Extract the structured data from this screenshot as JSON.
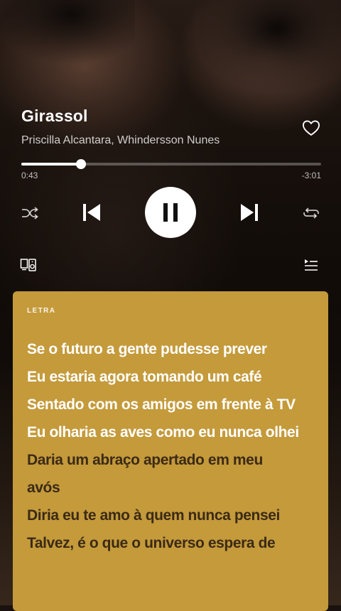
{
  "track": {
    "title": "Girassol",
    "artist": "Priscilla Alcantara, Whindersson Nunes"
  },
  "playback": {
    "elapsed": "0:43",
    "remaining": "-3:01",
    "progress_fraction": 0.2
  },
  "icons": {
    "heart": "heart-outline-icon",
    "shuffle": "shuffle-icon",
    "previous": "skip-previous-icon",
    "pause": "pause-icon",
    "next": "skip-next-icon",
    "repeat": "repeat-icon",
    "devices": "devices-icon",
    "queue": "queue-icon"
  },
  "lyrics": {
    "header": "LETRA",
    "card_color": "#c49a3b",
    "lines": [
      {
        "text": "Se o futuro a gente pudesse prever",
        "state": "past"
      },
      {
        "text": "Eu estaria agora tomando um café",
        "state": "past"
      },
      {
        "text": "Sentado com os amigos em frente à TV",
        "state": "past"
      },
      {
        "text": "Eu olharia as aves como eu nunca olhei",
        "state": "past"
      },
      {
        "text": "Daria um abraço apertado em meu",
        "state": "future"
      },
      {
        "text": "avós",
        "state": "future"
      },
      {
        "text": "Diria eu te amo à quem nunca pensei",
        "state": "future"
      },
      {
        "text": "Talvez, é o que o universo espera de",
        "state": "future"
      }
    ]
  }
}
